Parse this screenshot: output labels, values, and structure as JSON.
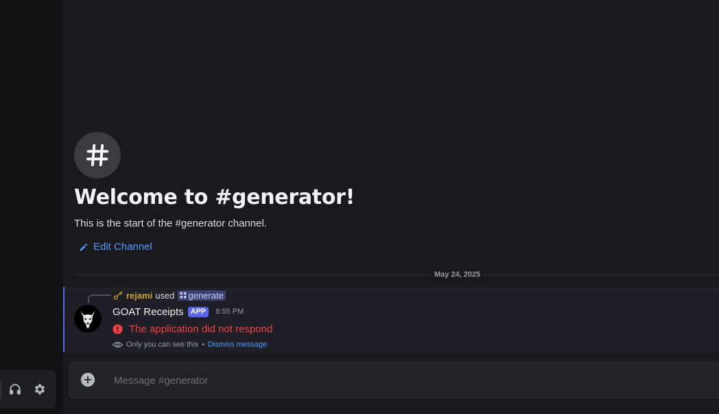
{
  "app": {
    "channel_name": "generator",
    "accent": "#5865f2",
    "link_color": "#4e9bff",
    "error_color": "#f23f42"
  },
  "user_panel": {
    "buttons": [
      {
        "name": "headphones-icon",
        "action": "deafen"
      },
      {
        "name": "gear-icon",
        "action": "user-settings"
      }
    ]
  },
  "welcome": {
    "icon": "hash-icon",
    "title": "Welcome to #generator!",
    "subtitle": "This is the start of the #generator channel.",
    "edit_label": "Edit Channel",
    "edit_icon": "pencil-icon"
  },
  "divider": {
    "date": "May 24, 2025"
  },
  "message": {
    "reply": {
      "icon": "key-icon",
      "user": "rejami",
      "used": "used",
      "command": "generate",
      "command_icon": "app-command-icon"
    },
    "author": "GOAT Receipts",
    "badge": "APP",
    "time": "8:55 PM",
    "error_text": "The application did not respond",
    "error_icon": "error-circle-icon",
    "ephemeral_text": "Only you can see this",
    "separator": "•",
    "dismiss": "Dismiss message",
    "ephemeral_icon": "eye-icon"
  },
  "composer": {
    "placeholder": "Message #generator",
    "add_icon": "plus-circle-icon"
  }
}
